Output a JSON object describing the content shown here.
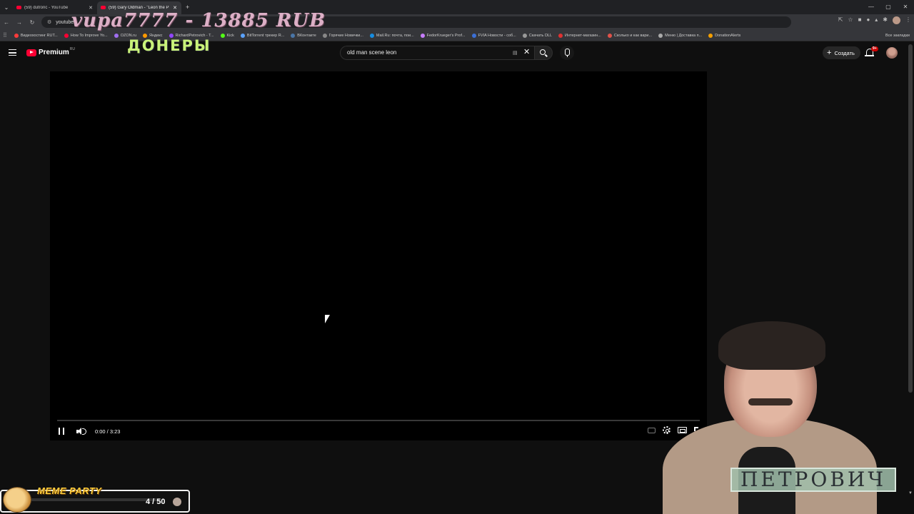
{
  "browser": {
    "tabs": [
      {
        "label": "(59) dutronc - YouTube",
        "active": false
      },
      {
        "label": "(59) Gary Oldman - \"Leon the P",
        "active": true
      }
    ],
    "new_tab_symbol": "+",
    "url_prefix": "youtube",
    "window_controls": [
      "—",
      "▢",
      "✕"
    ]
  },
  "bookmarks": [
    {
      "label": "Видеохостинг RUT...",
      "color": "#ff3b3b"
    },
    {
      "label": "How To Improve Yo...",
      "color": "#ff0033"
    },
    {
      "label": "OZON.ru",
      "color": "#a06ef0"
    },
    {
      "label": "Яндекс",
      "color": "#ff9a00"
    },
    {
      "label": "RichardPetrovich - T...",
      "color": "#9146ff"
    },
    {
      "label": "Kick",
      "color": "#53fc18"
    },
    {
      "label": "BitTorrent трекер R...",
      "color": "#5aa2ff"
    },
    {
      "label": "ВКонтакте",
      "color": "#4a76a8"
    },
    {
      "label": "Горячие Новички...",
      "color": "#888"
    },
    {
      "label": "Mail.Ru: почта, пои...",
      "color": "#168de2"
    },
    {
      "label": "FedorKrueger's Prof...",
      "color": "#c77dff"
    },
    {
      "label": "FVIA Новости - соб...",
      "color": "#3b6fd6"
    },
    {
      "label": "Скачать DLL",
      "color": "#999"
    },
    {
      "label": "Интернет-магазин...",
      "color": "#e03131"
    },
    {
      "label": "Сколько и как вари...",
      "color": "#e0524a"
    },
    {
      "label": "Меню | Доставка п...",
      "color": "#aaa"
    },
    {
      "label": "DonationAlerts",
      "color": "#f59f00"
    }
  ],
  "bookmarks_all": "Все закладки",
  "overlay": {
    "donation": "vupa7777 - 13885 RUB",
    "doners": "ДОНЕРЫ"
  },
  "youtube": {
    "brand": "Premium",
    "country": "RU",
    "search_query": "old man scene leon",
    "create_label": "Создать",
    "notification_count": "9+"
  },
  "player": {
    "time": "0:00 / 3:23",
    "progress": 0.0
  },
  "streamer": {
    "name": "ПЕТРОВИЧ"
  },
  "meme_widget": {
    "title": "MEME PARTY",
    "count": "4 / 50"
  }
}
